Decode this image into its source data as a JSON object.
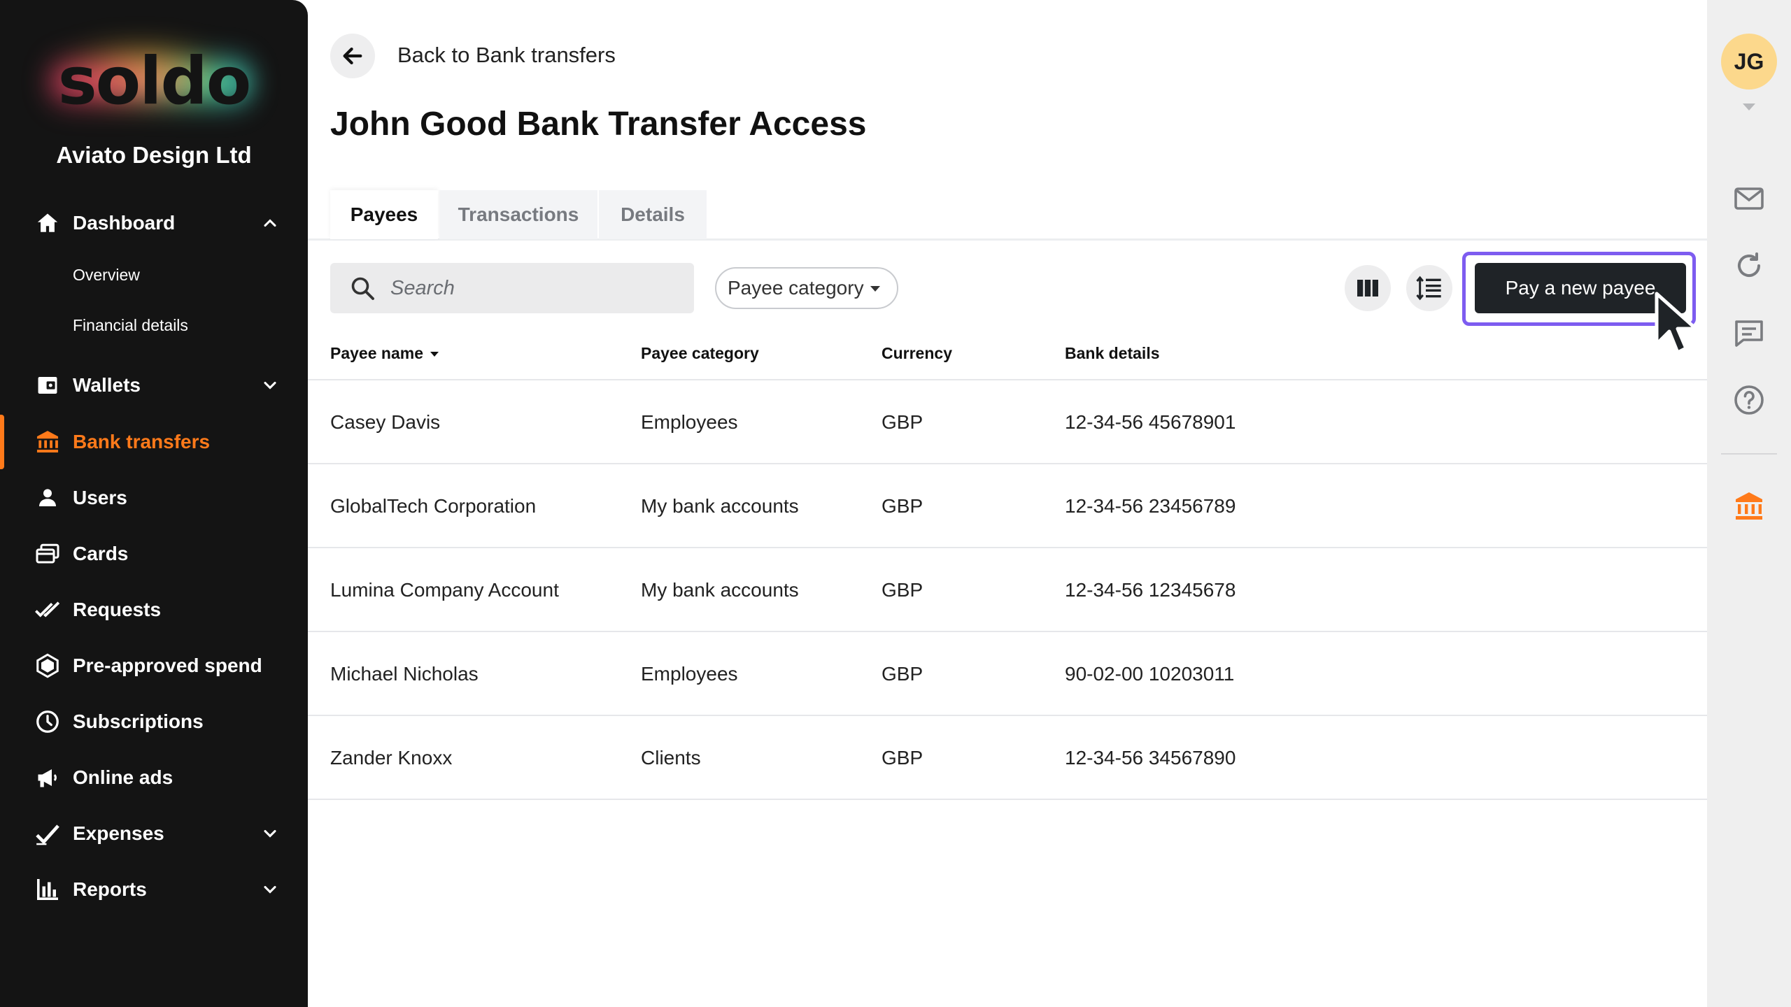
{
  "sidebar": {
    "logo_text": "soldo",
    "org_name": "Aviato Design Ltd",
    "items": {
      "dashboard": "Dashboard",
      "overview": "Overview",
      "financial_details": "Financial details",
      "wallets": "Wallets",
      "bank_transfers": "Bank transfers",
      "users": "Users",
      "cards": "Cards",
      "requests": "Requests",
      "pre_approved": "Pre-approved spend",
      "subscriptions": "Subscriptions",
      "online_ads": "Online ads",
      "expenses": "Expenses",
      "reports": "Reports"
    },
    "active_item": "Bank transfers",
    "active_color": "#ff7a1a"
  },
  "header": {
    "back_label": "Back to Bank transfers",
    "title": "John Good Bank Transfer Access"
  },
  "tabs": [
    {
      "label": "Payees",
      "active": true
    },
    {
      "label": "Transactions",
      "active": false
    },
    {
      "label": "Details",
      "active": false
    }
  ],
  "toolbar": {
    "search_placeholder": "Search",
    "filter_label": "Payee category",
    "pay_button": "Pay a new payee",
    "highlight_color": "#7d5cf0"
  },
  "table": {
    "headers": {
      "name": "Payee name",
      "category": "Payee category",
      "currency": "Currency",
      "bank": "Bank details"
    },
    "rows": [
      {
        "name": "Casey Davis",
        "category": "Employees",
        "currency": "GBP",
        "bank": "12-34-56 45678901"
      },
      {
        "name": "GlobalTech Corporation",
        "category": "My bank accounts",
        "currency": "GBP",
        "bank": "12-34-56 23456789"
      },
      {
        "name": "Lumina Company Account",
        "category": "My bank accounts",
        "currency": "GBP",
        "bank": "12-34-56 12345678"
      },
      {
        "name": "Michael Nicholas",
        "category": "Employees",
        "currency": "GBP",
        "bank": "90-02-00 10203011"
      },
      {
        "name": "Zander Knoxx",
        "category": "Clients",
        "currency": "GBP",
        "bank": "12-34-56 34567890"
      }
    ]
  },
  "rail": {
    "avatar_initials": "JG",
    "avatar_color": "#fcd88c",
    "icons": [
      "mail-icon",
      "refresh-icon",
      "chat-icon",
      "help-icon",
      "bank-icon"
    ]
  }
}
